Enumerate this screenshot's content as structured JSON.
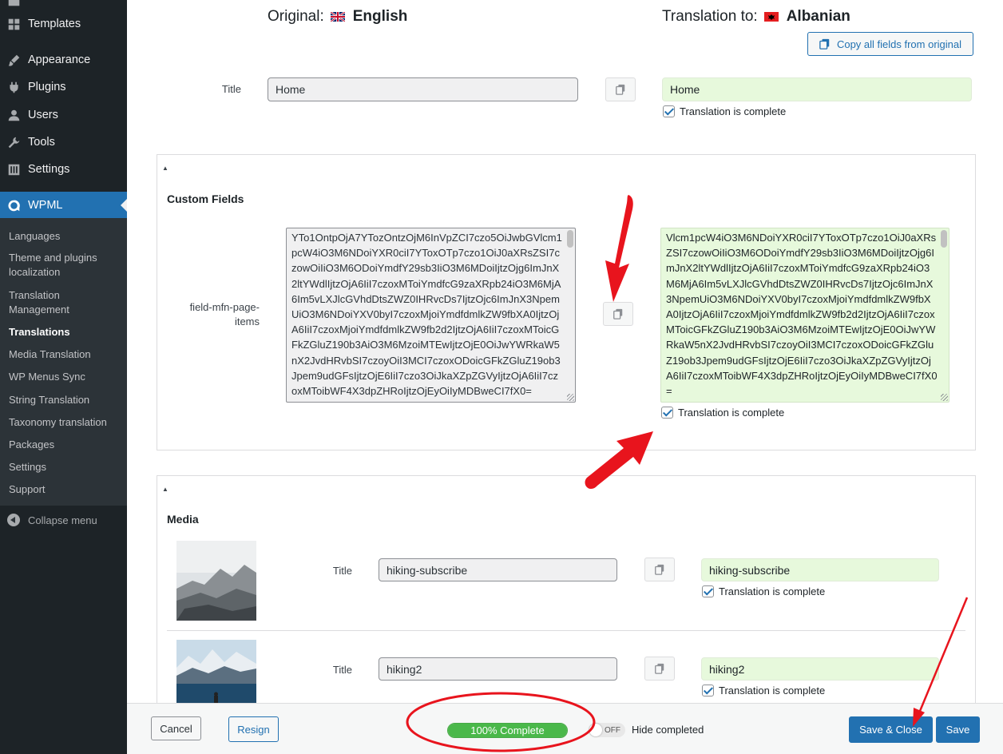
{
  "sidebar": {
    "top_items": [
      {
        "label": "Templates",
        "icon": "templates-icon"
      },
      {
        "label": "Appearance",
        "icon": "paintbrush-icon"
      },
      {
        "label": "Plugins",
        "icon": "plugin-icon"
      },
      {
        "label": "Users",
        "icon": "users-icon"
      },
      {
        "label": "Tools",
        "icon": "wrench-icon"
      },
      {
        "label": "Settings",
        "icon": "settings-icon"
      }
    ],
    "active_item": {
      "label": "WPML",
      "icon": "wpml-icon"
    },
    "submenu": [
      "Languages",
      "Theme and plugins localization",
      "Translation Management",
      "Translations",
      "Media Translation",
      "WP Menus Sync",
      "String Translation",
      "Taxonomy translation",
      "Packages",
      "Settings",
      "Support"
    ],
    "current_submenu": "Translations",
    "collapse_label": "Collapse menu"
  },
  "header": {
    "original_label": "Original:",
    "original_lang": "English",
    "translation_label": "Translation to:",
    "translation_lang": "Albanian",
    "copy_all_label": "Copy all fields from original"
  },
  "title_field": {
    "label": "Title",
    "original": "Home",
    "translation": "Home",
    "complete_label": "Translation is complete"
  },
  "custom_fields": {
    "heading": "Custom Fields",
    "field_label": "field-mfn-page-items",
    "original_text": "YTo1OntpOjA7YTozOntzOjM6InVpZCI7czo5OiJwbGVlcm1pcW4iO3M6NDoiYXR0ciI7YToxOTp7czo1OiJ0aXRsZSI7czowOiIiO3M6ODoiYmdfY29sb3IiO3M6MDoiIjtzOjg6ImJnX2ltYWdlIjtzOjA6IiI7czoxMToiYmdfcG9zaXRpb24iO3M6MjA6Im5vLXJlcGVhdDtsZWZ0IHRvcDs7IjtzOjc6ImJnX3NpemUiO3M6NDoiYXV0byI7czoxMjoiYmdfdmlkZW9fbXA0IjtzOjA6IiI7czoxMjoiYmdfdmlkZW9fb2d2IjtzOjA6IiI7czoxMToicGFkZGluZ190b3AiO3M6MzoiMTEwIjtzOjE0OiJwYWRkaW5nX2JvdHRvbSI7czoyOiI3MCI7czoxODoicGFkZGluZ19ob3Jpem9udGFsIjtzOjE6IiI7czo3OiJkaXZpZGVyIjtzOjA6IiI7czoxMToibWF4X3dpZHRoIjtzOjEyOiIyMDBweCI7fX0=",
    "translation_text": "Vlcm1pcW4iO3M6NDoiYXR0ciI7YToxOTp7czo1OiJ0aXRsZSI7czowOiIiO3M6ODoiYmdfY29sb3IiO3M6MDoiIjtzOjg6ImJnX2ltYWdlIjtzOjA6IiI7czoxMToiYmdfcG9zaXRpb24iO3M6MjA6Im5vLXJlcGVhdDtsZWZ0IHRvcDs7IjtzOjc6ImJnX3NpemUiO3M6NDoiYXV0byI7czoxMjoiYmdfdmlkZW9fbXA0IjtzOjA6IiI7czoxMjoiYmdfdmlkZW9fb2d2IjtzOjA6IiI7czoxMToicGFkZGluZ190b3AiO3M6MzoiMTEwIjtzOjE0OiJwYWRkaW5nX2JvdHRvbSI7czoyOiI3MCI7czoxODoicGFkZGluZ19ob3Jpem9udGFsIjtzOjE6IiI7czo3OiJkaXZpZGVyIjtzOjA6IiI7czoxMToibWF4X3dpZHRoIjtzOjEyOiIyMDBweCI7fX0=",
    "complete_label": "Translation is complete"
  },
  "media": {
    "heading": "Media",
    "items": [
      {
        "label": "Title",
        "original": "hiking-subscribe",
        "translation": "hiking-subscribe",
        "complete_label": "Translation is complete"
      },
      {
        "label": "Title",
        "original": "hiking2",
        "translation": "hiking2",
        "complete_label": "Translation is complete"
      }
    ]
  },
  "footer": {
    "cancel_label": "Cancel",
    "resign_label": "Resign",
    "progress_label": "100% Complete",
    "progress_fraction": 1.0,
    "toggle_label": "OFF",
    "hide_completed_label": "Hide completed",
    "save_close_label": "Save & Close",
    "save_label": "Save"
  },
  "colors": {
    "wp_blue": "#2271b1",
    "translation_green": "#e7f9dc",
    "progress_green": "#4ab84a",
    "annotation_red": "#e8141d"
  }
}
